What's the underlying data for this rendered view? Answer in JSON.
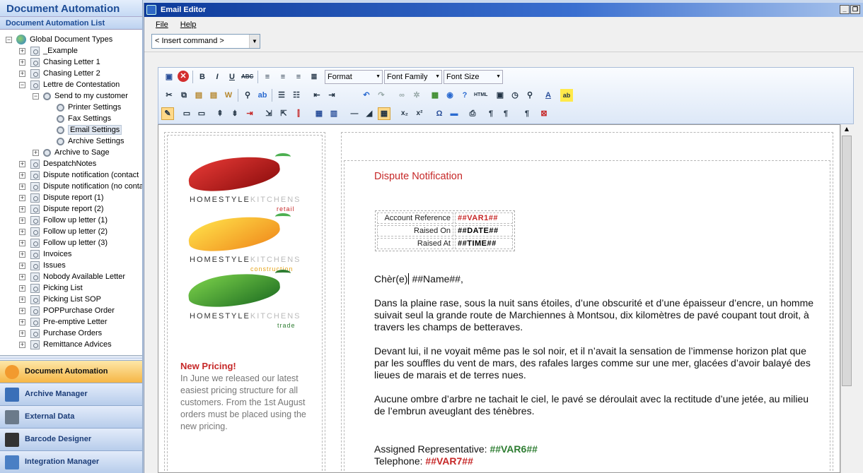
{
  "app": {
    "title": "Document Automation",
    "list_title": "Document Automation List"
  },
  "tree": [
    {
      "label": "Global Document Types",
      "icon": "globe-icon",
      "depth": 0,
      "expander": "−"
    },
    {
      "label": "_Example",
      "icon": "document-type-icon",
      "depth": 1,
      "expander": "+"
    },
    {
      "label": "Chasing Letter 1",
      "icon": "document-type-icon",
      "depth": 1,
      "expander": "+"
    },
    {
      "label": "Chasing Letter 2",
      "icon": "document-type-icon",
      "depth": 1,
      "expander": "+"
    },
    {
      "label": "Lettre de Contestation",
      "icon": "document-type-icon",
      "depth": 1,
      "expander": "−"
    },
    {
      "label": "Send to my customer",
      "icon": "gear-globe-icon",
      "depth": 2,
      "expander": "−"
    },
    {
      "label": "Printer Settings",
      "icon": "printer-icon",
      "depth": 3,
      "expander": ""
    },
    {
      "label": "Fax Settings",
      "icon": "fax-icon",
      "depth": 3,
      "expander": ""
    },
    {
      "label": "Email Settings",
      "icon": "email-icon",
      "depth": 3,
      "expander": "",
      "selected": true
    },
    {
      "label": "Archive Settings",
      "icon": "archive-icon",
      "depth": 3,
      "expander": ""
    },
    {
      "label": "Archive to Sage",
      "icon": "gear-globe-icon",
      "depth": 2,
      "expander": "+"
    },
    {
      "label": "DespatchNotes",
      "icon": "document-type-icon",
      "depth": 1,
      "expander": "+"
    },
    {
      "label": "Dispute notification (contact",
      "icon": "document-type-icon",
      "depth": 1,
      "expander": "+"
    },
    {
      "label": "Dispute notification (no conta",
      "icon": "document-type-icon",
      "depth": 1,
      "expander": "+"
    },
    {
      "label": "Dispute report (1)",
      "icon": "document-type-icon",
      "depth": 1,
      "expander": "+"
    },
    {
      "label": "Dispute report (2)",
      "icon": "document-type-icon",
      "depth": 1,
      "expander": "+"
    },
    {
      "label": "Follow up letter (1)",
      "icon": "document-type-icon",
      "depth": 1,
      "expander": "+"
    },
    {
      "label": "Follow up letter (2)",
      "icon": "document-type-icon",
      "depth": 1,
      "expander": "+"
    },
    {
      "label": "Follow up letter (3)",
      "icon": "document-type-icon",
      "depth": 1,
      "expander": "+"
    },
    {
      "label": "Invoices",
      "icon": "document-type-icon",
      "depth": 1,
      "expander": "+"
    },
    {
      "label": "Issues",
      "icon": "document-type-icon",
      "depth": 1,
      "expander": "+"
    },
    {
      "label": "Nobody Available Letter",
      "icon": "document-type-icon",
      "depth": 1,
      "expander": "+"
    },
    {
      "label": "Picking List",
      "icon": "document-type-icon",
      "depth": 1,
      "expander": "+"
    },
    {
      "label": "Picking List SOP",
      "icon": "document-type-icon",
      "depth": 1,
      "expander": "+"
    },
    {
      "label": "POPPurchase Order",
      "icon": "document-type-icon",
      "depth": 1,
      "expander": "+"
    },
    {
      "label": "Pre-emptive Letter",
      "icon": "document-type-icon",
      "depth": 1,
      "expander": "+"
    },
    {
      "label": "Purchase Orders",
      "icon": "document-type-icon",
      "depth": 1,
      "expander": "+"
    },
    {
      "label": "Remittance Advices",
      "icon": "document-type-icon",
      "depth": 1,
      "expander": "+"
    }
  ],
  "nav": [
    {
      "label": "Document Automation",
      "icon": "document-automation-icon",
      "active": true
    },
    {
      "label": "Archive Manager",
      "icon": "archive-manager-icon",
      "active": false
    },
    {
      "label": "External Data",
      "icon": "database-icon",
      "active": false
    },
    {
      "label": "Barcode Designer",
      "icon": "barcode-icon",
      "active": false
    },
    {
      "label": "Integration Manager",
      "icon": "integration-icon",
      "active": false
    }
  ],
  "editor": {
    "title": "Email Editor",
    "menu": [
      "File",
      "Help"
    ],
    "insert_command": "< Insert command >",
    "combos": {
      "format": "Format",
      "font_family": "Font Family",
      "font_size": "Font Size"
    }
  },
  "colors": {
    "accent_red": "#c62828",
    "accent_green": "#2e7d32",
    "title_blue": "#1c4c96",
    "nav_active": "#f6b645"
  },
  "logo": {
    "brand_a": "HOMESTYLE",
    "brand_b": "KITCHENS",
    "sub1": "retail",
    "sub2": "construction",
    "sub3": "trade"
  },
  "sidebar_promo": {
    "title": "New Pricing!",
    "body": "In June we released our latest easiest pricing structure for all customers. From the 1st August orders must be placed using the new pricing."
  },
  "letter": {
    "title": "Dispute Notification",
    "fields": [
      {
        "label": "Account Reference",
        "value": "##VAR1##",
        "color": "red"
      },
      {
        "label": "Raised On",
        "value": "##DATE##",
        "color": "black"
      },
      {
        "label": "Raised At",
        "value": "##TIME##",
        "color": "black"
      }
    ],
    "greeting_prefix": "Chèr(e)",
    "greeting_var": "##Name##,",
    "paragraphs": [
      "Dans la plaine rase, sous la nuit sans étoiles, d’une obscurité et d’une épaisseur d’encre, un homme suivait seul la grande route de Marchiennes à Montsou, dix kilomètres de pavé coupant tout droit, à travers les champs de betteraves.",
      "Devant lui, il ne voyait même pas le sol noir, et il n’avait la sensation de l’immense horizon plat que par les souffles du vent de mars, des rafales larges comme sur une mer, glacées d’avoir balayé des lieues de marais et de terres nues.",
      "Aucune ombre d’arbre ne tachait le ciel, le pavé se déroulait avec la rectitude d’une jetée, au milieu de l’embrun aveuglant des ténèbres."
    ],
    "rep_label": "Assigned Representative:",
    "rep_value": "##VAR6##",
    "tel_label": "Telephone:",
    "tel_value": "##VAR7##"
  }
}
